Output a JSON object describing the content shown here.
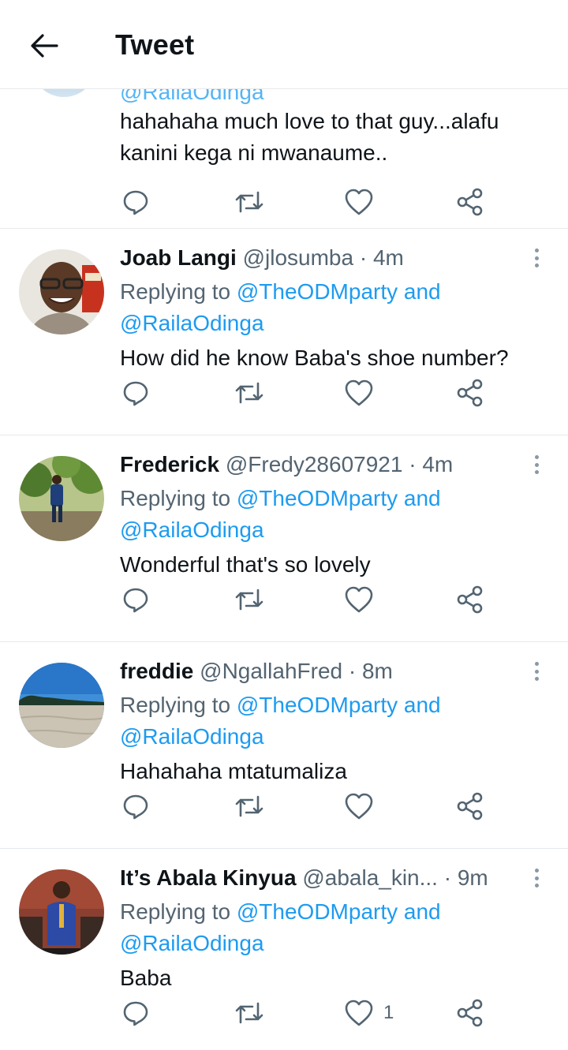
{
  "header": {
    "title": "Tweet",
    "back_icon": "arrow-left-icon"
  },
  "partial_tweet": {
    "handle_cut": "@RailaOdinga",
    "text_line1": "hahahaha much love to that guy...alafu",
    "text_line2": "kanini kega ni mwanaume.."
  },
  "tweets": [
    {
      "name": "Joab Langi",
      "handle": "@jlosumba",
      "time": "· 4m",
      "replying_label": "Replying to",
      "mention1": "@TheODMparty",
      "and": "and",
      "mention2": "@RailaOdinga",
      "text": "How did he know Baba's shoe number?",
      "like_count": ""
    },
    {
      "name": "Frederick",
      "handle": "@Fredy28607921",
      "time": "· 4m",
      "replying_label": "Replying to",
      "mention1": "@TheODMparty",
      "and": "and",
      "mention2": "@RailaOdinga",
      "text": "Wonderful that's so lovely",
      "like_count": ""
    },
    {
      "name": "freddie",
      "handle": "@NgallahFred",
      "time": "· 8m",
      "replying_label": "Replying to",
      "mention1": "@TheODMparty",
      "and": "and",
      "mention2": "@RailaOdinga",
      "text": "Hahahaha mtatumaliza",
      "like_count": ""
    },
    {
      "name": "It’s Abala Kinyua",
      "handle": "@abala_kin...",
      "time": " · 9m",
      "replying_label": "Replying to",
      "mention1": "@TheODMparty",
      "and": "and",
      "mention2": "@RailaOdinga",
      "text": "Baba",
      "like_count": "1"
    }
  ],
  "colors": {
    "link": "#1d9bf0",
    "secondary": "#536471",
    "divider": "#e6e9ec"
  }
}
